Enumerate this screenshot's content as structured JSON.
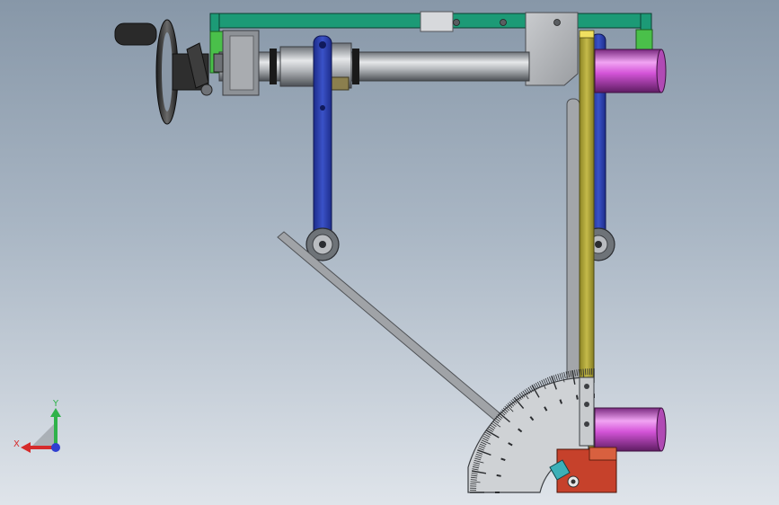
{
  "viewport": {
    "background_top": "#8797a8",
    "background_bottom": "#dfe4ea"
  },
  "colors": {
    "frame_green": "#1c9a76",
    "link_blue": "#2a3fae",
    "post_olive": "#b3a83b",
    "magenta_cylinder": "#d454d8",
    "bracket_red": "#c6412b",
    "steel_grey": "#a3a6aa",
    "dark_grey": "#2b2b2b"
  },
  "protractor": {
    "tick_count": 90,
    "major_every": 10
  },
  "triad": {
    "x_label": "X",
    "y_label": "Y",
    "x_color": "#d62b2b",
    "y_color": "#2fb24a",
    "z_color": "#2f3fd0"
  },
  "icons": {
    "handwheel": "handwheel-icon",
    "orientation": "orientation-triad-icon"
  }
}
